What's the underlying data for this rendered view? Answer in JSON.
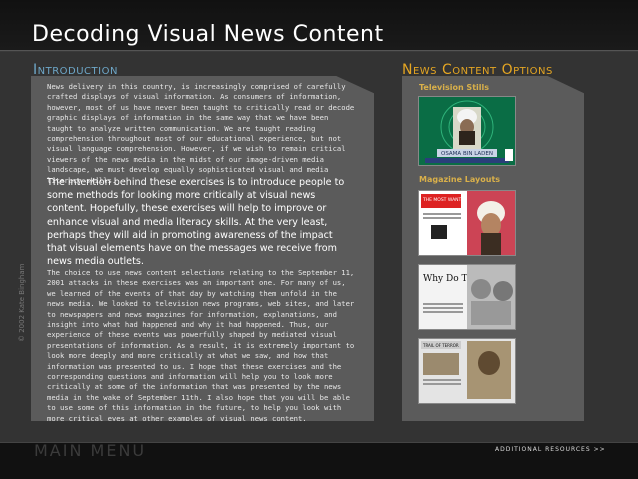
{
  "header": {
    "title": "Decoding Visual News Content"
  },
  "intro": {
    "title": "Introduction",
    "p1": "News delivery in this country, is increasingly comprised of carefully crafted displays of visual information. As consumers of information, however, most of us have never been taught to critically read or decode graphic displays of information in the same way that we have been taught to analyze written communication. We are taught reading comprehension throughout most of our educational experience, but not visual language comprehension. However, if we wish to remain critical viewers of the news media in the midst of our image-driven media landscape, we must develop equally sophisticated visual and media literacy skills.",
    "p2": "The intention behind these exercises is to introduce people to some methods for looking more critically at visual news content. Hopefully, these exercises will help to improve or enhance visual and media literacy skills. At the very least, perhaps they will aid in promoting awareness of the impact that visual elements have on the messages we receive from news media outlets.",
    "p3": "The choice to use news content selections relating to the September 11, 2001 attacks in these exercises was an important one. For many of us, we learned of the events of that day by watching them unfold in the news media. We looked to television news programs, web sites, and later to newspapers and news magazines for information, explanations, and insight into what had happened and why it had happened. Thus, our experience of these events was powerfully shaped by mediated visual presentations of information. As a result, it is extremely important to look more deeply and more critically at what we saw, and how that information was presented to us. I hope that these exercises and the corresponding questions and information will help you to look more critically at some of the information that was presented by the news media in the wake of September 11th. I also hope that you will be able to use some of this information in the future, to help you look with more critical eyes at other examples of visual news content.",
    "copyright": "© 2002 Kate Bingham"
  },
  "options": {
    "title": "News Content Options",
    "tv_label": "Television Stills",
    "mag_label": "Magazine Layouts",
    "tv_thumb_caption": "OSAMA BIN LADEN"
  },
  "magazines": {
    "m1_headline": "THE MOST WANTED MAN IN THE WORLD",
    "m2_headline": "Why Do They Hate Us?",
    "m3_headline": "TRAIL OF TERROR"
  },
  "footer": {
    "main_menu": "MAIN MENU",
    "additional_resources": "ADDITIONAL RESOURCES >>"
  },
  "colors": {
    "intro_accent": "#6ea7c8",
    "options_accent": "#e5a623",
    "panel_bg": "#5b5b5b"
  }
}
